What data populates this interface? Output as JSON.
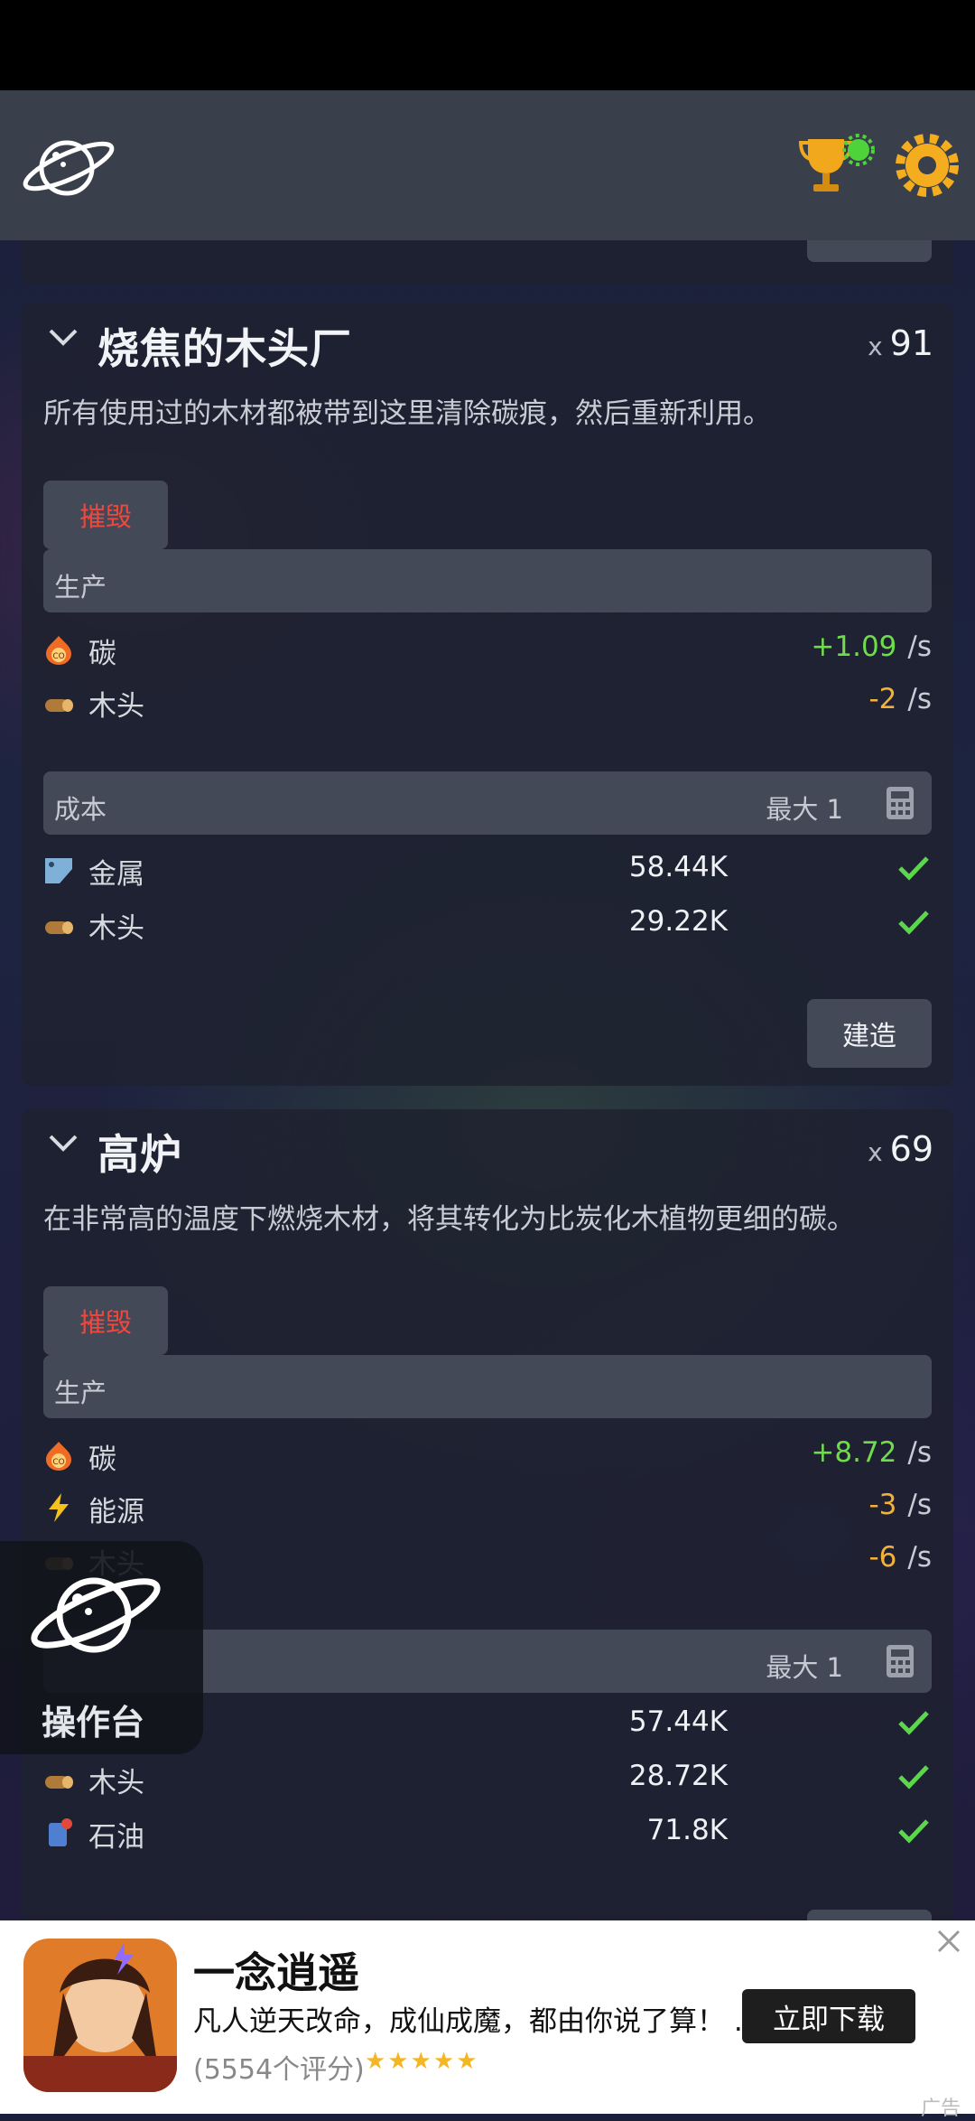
{
  "colors": {
    "accent_green": "#6fdc4a",
    "negative_orange": "#f4b13a",
    "destroy_red": "#f0483e",
    "topbar": "#3a3f4c"
  },
  "topbar": {
    "logo_icon": "planet-icon",
    "trophy_icon": "trophy-icon",
    "settings_icon": "gear-icon"
  },
  "cards": [
    {
      "title": "烧焦的木头厂",
      "count_prefix": "x",
      "count": "91",
      "description": "所有使用过的木材都被带到这里清除碳痕，然后重新利用。",
      "destroy_label": "摧毁",
      "production_label": "生产",
      "production": [
        {
          "icon": "carbon-icon",
          "name": "碳",
          "rate": "+1.09",
          "unit": "/s"
        },
        {
          "icon": "wood-icon",
          "name": "木头",
          "rate": "-2",
          "unit": "/s"
        }
      ],
      "cost_label": "成本",
      "max_label": "最大 1",
      "costs": [
        {
          "icon": "metal-icon",
          "name": "金属",
          "amount": "58.44K"
        },
        {
          "icon": "wood-icon",
          "name": "木头",
          "amount": "29.22K"
        }
      ],
      "build_label": "建造"
    },
    {
      "title": "高炉",
      "count_prefix": "x",
      "count": "69",
      "description": "在非常高的温度下燃烧木材，将其转化为比炭化木植物更细的碳。",
      "destroy_label": "摧毁",
      "production_label": "生产",
      "production": [
        {
          "icon": "carbon-icon",
          "name": "碳",
          "rate": "+8.72",
          "unit": "/s"
        },
        {
          "icon": "energy-icon",
          "name": "能源",
          "rate": "-3",
          "unit": "/s"
        },
        {
          "icon": "wood-icon",
          "name": "木头",
          "rate": "-6",
          "unit": "/s"
        }
      ],
      "max_label": "最大 1",
      "costs": [
        {
          "icon": "metal-icon",
          "amount": "57.44K"
        },
        {
          "icon": "wood-icon",
          "name": "木头",
          "amount": "28.72K"
        },
        {
          "icon": "oil-icon",
          "name": "石油",
          "amount": "71.8K"
        }
      ]
    }
  ],
  "console": {
    "label": "操作台"
  },
  "ad": {
    "app_name": "一念逍遥",
    "description": "凡人逆天改命，成仙成魔，都由你说了算！ ...",
    "rating": "(5554个评分)",
    "stars": "★★★★★",
    "download_label": "立即下载",
    "tag": "广告"
  }
}
